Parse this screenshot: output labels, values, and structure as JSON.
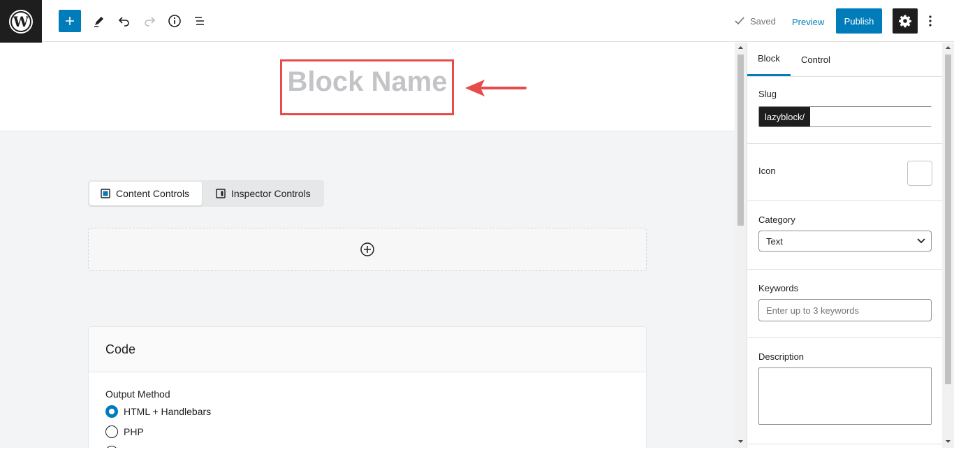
{
  "toolbar": {
    "logo": "wordpress-icon",
    "add_block": "plus-icon",
    "tools": [
      "pencil-icon",
      "undo-icon",
      "redo-icon",
      "info-icon",
      "list-view-icon"
    ],
    "saved_label": "Saved",
    "preview_label": "Preview",
    "publish_label": "Publish",
    "settings_icon": "gear-icon",
    "more_icon": "vertical-ellipsis-icon"
  },
  "editor": {
    "title_placeholder": "Block Name",
    "tabs": [
      {
        "label": "Content Controls",
        "icon": "content-controls-icon",
        "active": true
      },
      {
        "label": "Inspector Controls",
        "icon": "inspector-controls-icon",
        "active": false
      }
    ],
    "add_control_icon": "plus-circle-icon",
    "code_panel": {
      "title": "Code",
      "output_label": "Output Method",
      "options": [
        {
          "label": "HTML + Handlebars",
          "checked": true
        },
        {
          "label": "PHP",
          "checked": false
        }
      ]
    }
  },
  "sidebar": {
    "tabs": [
      {
        "label": "Block",
        "active": true
      },
      {
        "label": "Control",
        "active": false
      }
    ],
    "slug": {
      "label": "Slug",
      "prefix": "lazyblock/",
      "value": ""
    },
    "icon": {
      "label": "Icon"
    },
    "category": {
      "label": "Category",
      "value": "Text"
    },
    "keywords": {
      "label": "Keywords",
      "placeholder": "Enter up to 3 keywords"
    },
    "description": {
      "label": "Description",
      "value": ""
    }
  },
  "colors": {
    "accent": "#007cba",
    "annotation": "#e74c4c",
    "dark": "#1e1e1e"
  }
}
